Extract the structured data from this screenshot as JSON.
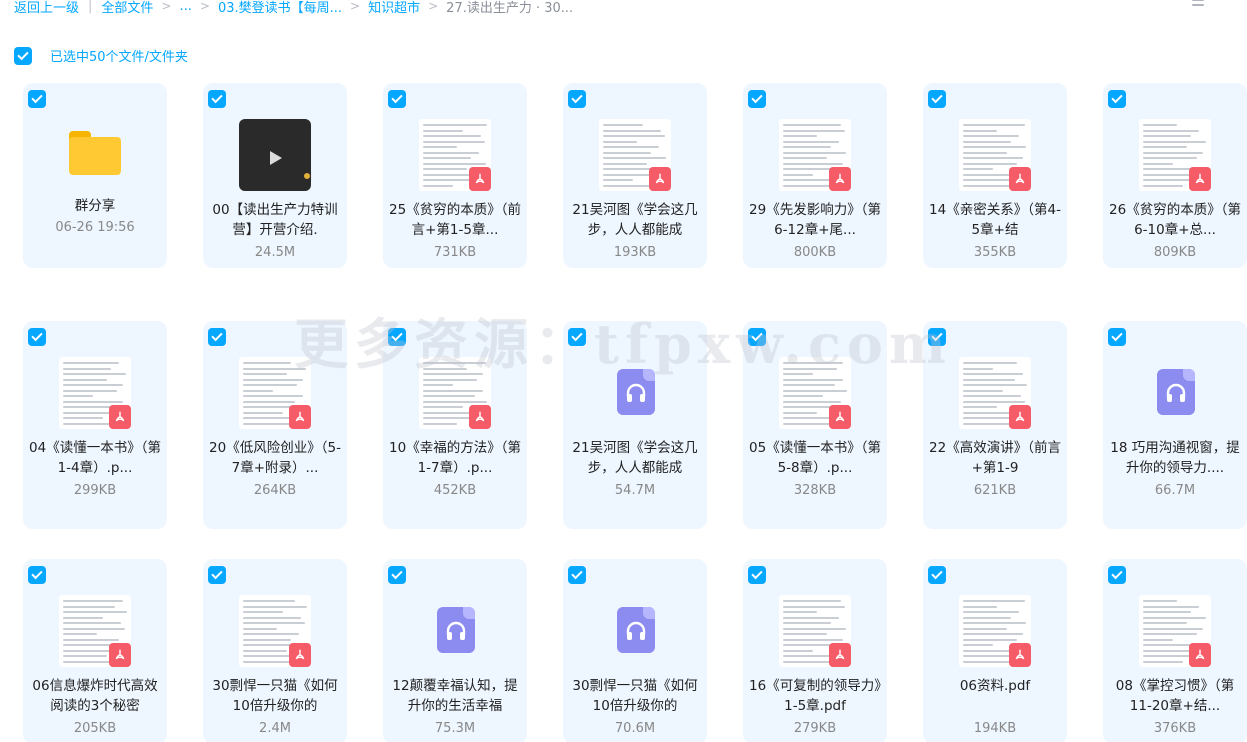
{
  "breadcrumb": {
    "back": "返回上一级",
    "all_files": "全部文件",
    "ellipsis": "...",
    "folder1": "03.樊登读书【每周...",
    "folder2": "知识超市",
    "current": "27.读出生产力 · 30..."
  },
  "selection": {
    "label": "已选中50个文件/文件夹"
  },
  "watermark": "更多资源：tfpxw.com",
  "colors": {
    "accent": "#06a7ff",
    "pdf": "#f55c68",
    "audio": "#8b8bf0",
    "folder": "#ffc933",
    "card_bg": "#eef6ff"
  },
  "files": [
    {
      "type": "folder",
      "icon": "folder-icon",
      "name": "群分享",
      "meta": "06-26 19:56"
    },
    {
      "type": "video",
      "icon": "video-thumbnail",
      "name": "00【读出生产力特训营】开营介绍.",
      "meta": "24.5M"
    },
    {
      "type": "pdf",
      "icon": "pdf-icon",
      "name": "25《贫穷的本质》（前言+第1-5章...",
      "meta": "731KB"
    },
    {
      "type": "pdf",
      "icon": "pdf-icon",
      "name": "21吴河图《学会这几步，人人都能成",
      "meta": "193KB"
    },
    {
      "type": "pdf",
      "icon": "pdf-icon",
      "name": "29《先发影响力》（第6-12章+尾...",
      "meta": "800KB"
    },
    {
      "type": "pdf",
      "icon": "pdf-icon",
      "name": "14《亲密关系》（第4-5章+结",
      "meta": "355KB"
    },
    {
      "type": "pdf",
      "icon": "pdf-icon",
      "name": "26《贫穷的本质》（第6-10章+总...",
      "meta": "809KB"
    },
    {
      "type": "pdf",
      "icon": "pdf-icon",
      "name": "04《读懂一本书》（第1-4章）.p...",
      "meta": "299KB"
    },
    {
      "type": "pdf",
      "icon": "pdf-icon",
      "name": "20《低风险创业》（5-7章+附录）...",
      "meta": "264KB"
    },
    {
      "type": "pdf",
      "icon": "pdf-icon",
      "name": "10《幸福的方法》（第1-7章）.p...",
      "meta": "452KB"
    },
    {
      "type": "audio",
      "icon": "audio-file-icon",
      "name": "21吴河图《学会这几步，人人都能成",
      "meta": "54.7M"
    },
    {
      "type": "pdf",
      "icon": "pdf-icon",
      "name": "05《读懂一本书》（第5-8章）.p...",
      "meta": "328KB"
    },
    {
      "type": "pdf",
      "icon": "pdf-icon",
      "name": "22《高效演讲》（前言+第1-9",
      "meta": "621KB"
    },
    {
      "type": "audio",
      "icon": "audio-file-icon",
      "name": "18 巧用沟通视窗，提升你的领导力....",
      "meta": "66.7M"
    },
    {
      "type": "pdf",
      "icon": "pdf-icon",
      "name": "06信息爆炸时代高效阅读的3个秘密",
      "meta": "205KB"
    },
    {
      "type": "pdf",
      "icon": "pdf-icon",
      "name": "30剽悍一只猫《如何10倍升级你的",
      "meta": "2.4M"
    },
    {
      "type": "audio",
      "icon": "audio-file-icon",
      "name": "12颠覆幸福认知，提升你的生活幸福",
      "meta": "75.3M"
    },
    {
      "type": "audio",
      "icon": "audio-file-icon",
      "name": "30剽悍一只猫《如何10倍升级你的",
      "meta": "70.6M"
    },
    {
      "type": "pdf",
      "icon": "pdf-icon",
      "name": "16《可复制的领导力》1-5章.pdf",
      "meta": "279KB"
    },
    {
      "type": "pdf",
      "icon": "pdf-icon",
      "name": "06资料.pdf",
      "meta": "194KB"
    },
    {
      "type": "pdf",
      "icon": "pdf-icon",
      "name": "08《掌控习惯》（第11-20章+结...",
      "meta": "376KB"
    }
  ]
}
